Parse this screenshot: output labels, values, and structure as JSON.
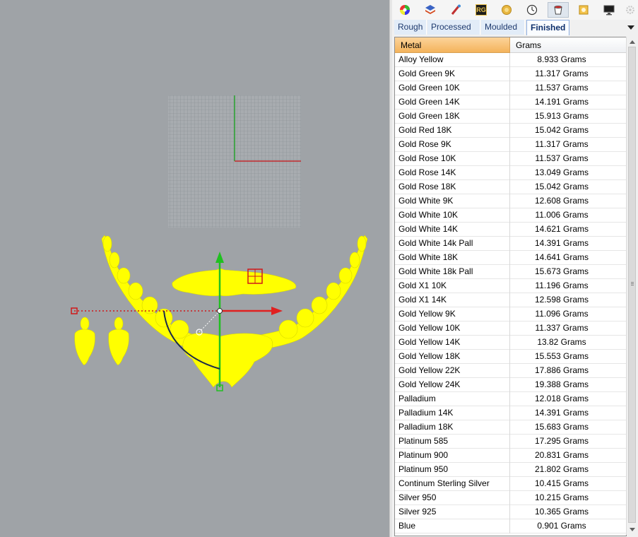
{
  "toolbar": {
    "tools": [
      {
        "icon": "color-wheel-icon"
      },
      {
        "icon": "layers-icon"
      },
      {
        "icon": "brush-icon"
      },
      {
        "icon": "rg-logo-icon",
        "text": "RG"
      },
      {
        "icon": "gem-icon"
      },
      {
        "icon": "clock-icon"
      },
      {
        "icon": "bucket-icon"
      },
      {
        "icon": "ring-icon"
      },
      {
        "icon": "monitor-icon"
      },
      {
        "icon": "gear-icon"
      }
    ]
  },
  "tabs": {
    "items": [
      "Rough",
      "Processed",
      "Moulded",
      "Finished"
    ],
    "active": "Finished"
  },
  "table": {
    "headers": {
      "metal": "Metal",
      "grams": "Grams"
    },
    "rows": [
      {
        "metal": "Alloy Yellow",
        "grams": "8.933 Grams"
      },
      {
        "metal": "Gold Green 9K",
        "grams": "11.317 Grams"
      },
      {
        "metal": "Gold Green 10K",
        "grams": "11.537 Grams"
      },
      {
        "metal": "Gold Green 14K",
        "grams": "14.191 Grams"
      },
      {
        "metal": "Gold Green 18K",
        "grams": "15.913 Grams"
      },
      {
        "metal": "Gold Red 18K",
        "grams": "15.042 Grams"
      },
      {
        "metal": "Gold Rose 9K",
        "grams": "11.317 Grams"
      },
      {
        "metal": "Gold Rose 10K",
        "grams": "11.537 Grams"
      },
      {
        "metal": "Gold Rose 14K",
        "grams": "13.049 Grams"
      },
      {
        "metal": "Gold Rose 18K",
        "grams": "15.042 Grams"
      },
      {
        "metal": "Gold White 9K",
        "grams": "12.608 Grams"
      },
      {
        "metal": "Gold White 10K",
        "grams": "11.006 Grams"
      },
      {
        "metal": "Gold White 14K",
        "grams": "14.621 Grams"
      },
      {
        "metal": "Gold White 14k Pall",
        "grams": "14.391 Grams"
      },
      {
        "metal": "Gold White 18K",
        "grams": "14.641 Grams"
      },
      {
        "metal": "Gold White 18k Pall",
        "grams": "15.673 Grams"
      },
      {
        "metal": "Gold X1 10K",
        "grams": "11.196 Grams"
      },
      {
        "metal": "Gold X1 14K",
        "grams": "12.598 Grams"
      },
      {
        "metal": "Gold Yellow 9K",
        "grams": "11.096 Grams"
      },
      {
        "metal": "Gold Yellow 10K",
        "grams": "11.337 Grams"
      },
      {
        "metal": "Gold Yellow 14K",
        "grams": "13.82 Grams"
      },
      {
        "metal": "Gold Yellow 18K",
        "grams": "15.553 Grams"
      },
      {
        "metal": "Gold Yellow 22K",
        "grams": "17.886 Grams"
      },
      {
        "metal": "Gold Yellow 24K",
        "grams": "19.388 Grams"
      },
      {
        "metal": "Palladium",
        "grams": "12.018 Grams"
      },
      {
        "metal": "Palladium 14K",
        "grams": "14.391 Grams"
      },
      {
        "metal": "Palladium 18K",
        "grams": "15.683 Grams"
      },
      {
        "metal": "Platinum 585",
        "grams": "17.295 Grams"
      },
      {
        "metal": "Platinum 900",
        "grams": "20.831 Grams"
      },
      {
        "metal": "Platinum 950",
        "grams": "21.802 Grams"
      },
      {
        "metal": "Continum Sterling Silver",
        "grams": "10.415 Grams"
      },
      {
        "metal": "Silver 950",
        "grams": "10.215 Grams"
      },
      {
        "metal": "Silver 925",
        "grams": "10.365 Grams"
      },
      {
        "metal": "Blue",
        "grams": "0.901 Grams"
      }
    ]
  },
  "viewport": {
    "model_color": "#ffff00",
    "x_axis_color": "#e02020",
    "y_axis_color": "#20c020",
    "background": "#9fa3a7"
  }
}
